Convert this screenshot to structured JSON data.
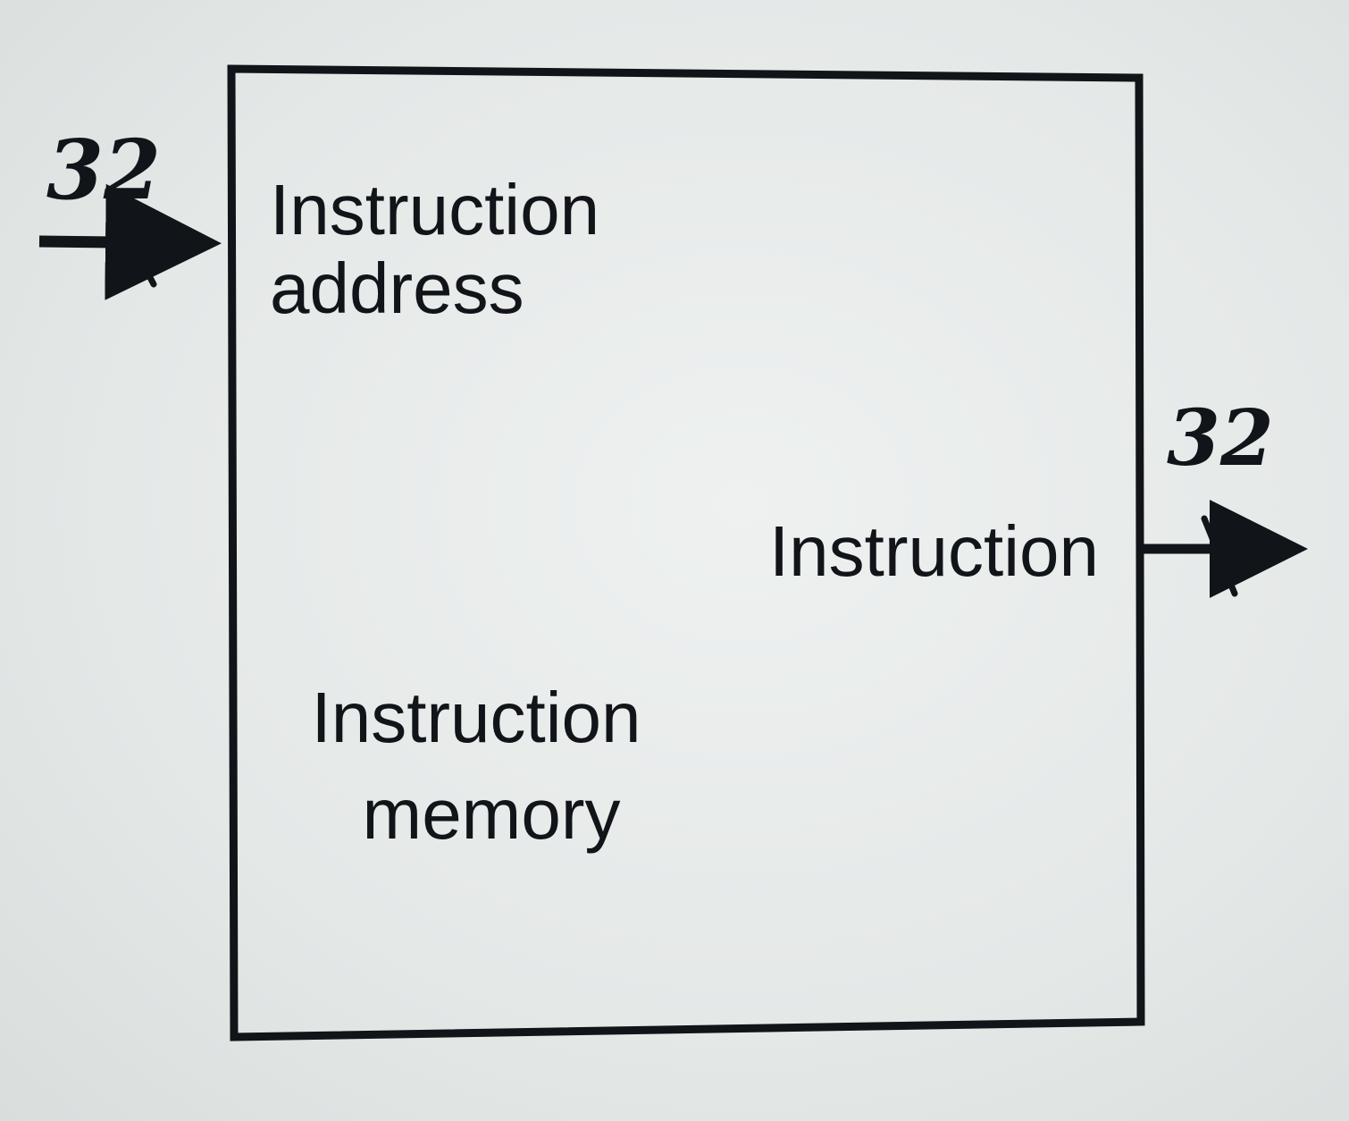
{
  "diagram": {
    "block": {
      "title_line1": "Instruction",
      "title_line2": "memory"
    },
    "input": {
      "label_line1": "Instruction",
      "label_line2": "address",
      "bus_width": "32"
    },
    "output": {
      "label": "Instruction",
      "bus_width": "32"
    }
  },
  "colors": {
    "ink": "#111418",
    "paper": "#e6eae9"
  }
}
